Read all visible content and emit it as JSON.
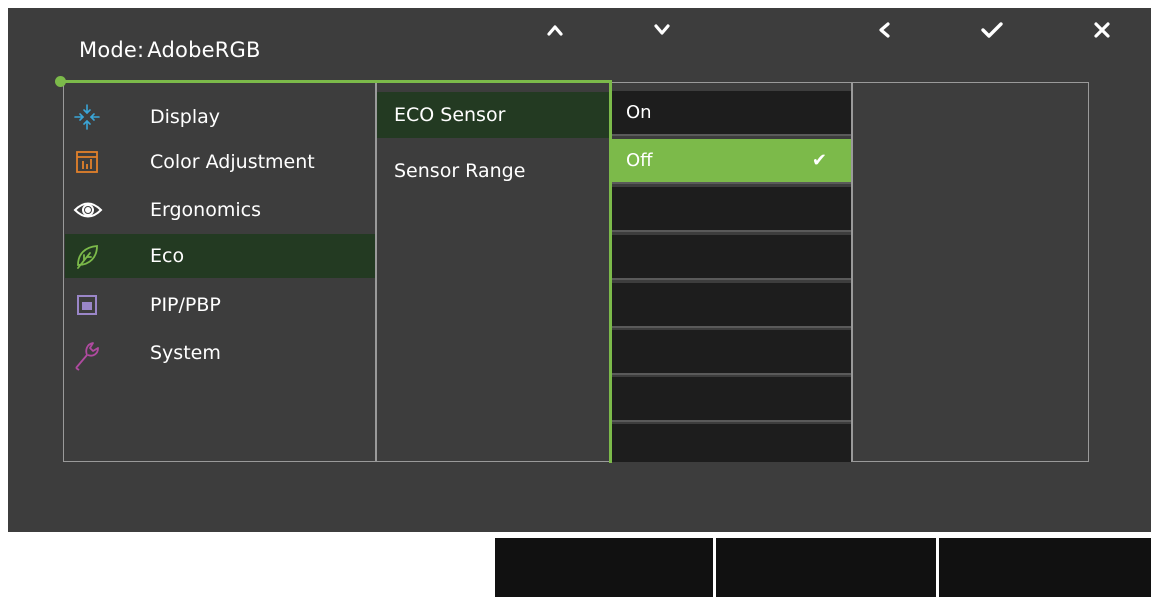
{
  "mode": {
    "label": "Mode:",
    "value": "AdobeRGB"
  },
  "menu": [
    {
      "label": "Display",
      "icon": "display-icon",
      "color": "#3aa6d8"
    },
    {
      "label": "Color Adjustment",
      "icon": "color-adjustment-icon",
      "color": "#e2802a"
    },
    {
      "label": "Ergonomics",
      "icon": "eye-icon",
      "color": "#ffffff"
    },
    {
      "label": "Eco",
      "icon": "leaf-icon",
      "color": "#7cba4a",
      "selected": true
    },
    {
      "label": "PIP/PBP",
      "icon": "pip-icon",
      "color": "#9a86c8"
    },
    {
      "label": "System",
      "icon": "wrench-icon",
      "color": "#b04aa0"
    }
  ],
  "submenu": [
    {
      "label": "ECO Sensor",
      "selected": true
    },
    {
      "label": "Sensor Range"
    }
  ],
  "options": [
    {
      "label": "On"
    },
    {
      "label": "Off",
      "selected": true,
      "checked": "✔"
    },
    {
      "label": ""
    },
    {
      "label": ""
    },
    {
      "label": ""
    },
    {
      "label": ""
    },
    {
      "label": ""
    },
    {
      "label": ""
    }
  ],
  "buttons": {
    "up": "up-arrow-icon",
    "down": "down-arrow-icon",
    "back": "left-arrow-icon",
    "ok": "check-icon",
    "exit": "close-icon"
  },
  "colors": {
    "accent": "#7cba4a",
    "panel": "#3d3d3d",
    "selected_row": "#233a22"
  }
}
